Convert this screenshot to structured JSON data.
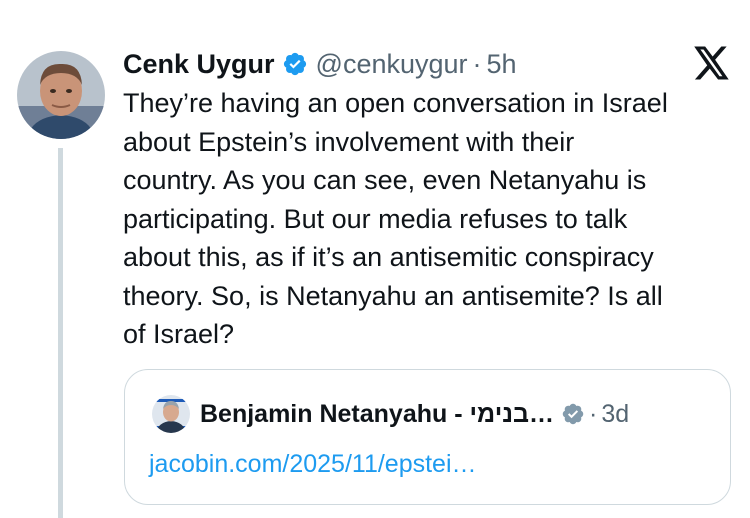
{
  "tweet": {
    "author_name": "Cenk Uygur",
    "author_handle": "@cenkuygur",
    "separator": "·",
    "time": "5h",
    "text": "They’re having an open conversation in Israel\nabout Epstein’s involvement with their\ncountry. As you can see, even Netanyahu is\nparticipating. But our media refuses to talk\nabout this, as if it’s an antisemitic conspiracy\ntheory. So, is Netanyahu an antisemite? Is all\nof Israel?"
  },
  "quote": {
    "author_name": "Benjamin Netanyahu - בנימי…",
    "separator": "·",
    "time": "3d",
    "link_text": "jacobin.com/2025/11/epstei…"
  },
  "icons": {
    "verified_badge": "verified-blue-check-icon",
    "quote_verified_badge": "verified-gray-check-icon",
    "platform_logo": "x-logo-icon"
  },
  "colors": {
    "text_primary": "#0f1419",
    "text_secondary": "#536471",
    "link": "#1d9bf0",
    "verified_blue": "#1d9bf0",
    "verified_gray": "#829aab",
    "border": "#cfd9de"
  }
}
